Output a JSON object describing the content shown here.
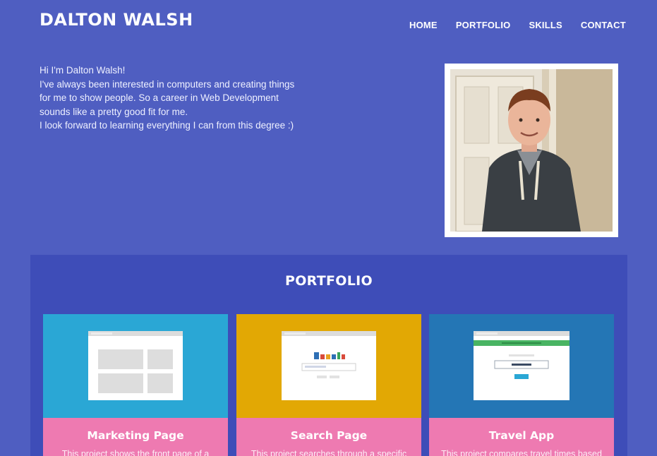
{
  "header": {
    "brand": "DALTON WALSH",
    "nav": [
      "HOME",
      "PORTFOLIO",
      "SKILLS",
      "CONTACT"
    ]
  },
  "intro": {
    "lines": [
      "Hi I'm Dalton Walsh!",
      "I've always been interested in computers and creating things",
      "for me to show people. So a career in Web Development",
      "sounds like a pretty good fit for me.",
      "I look forward to learning everything I can from this degree :)"
    ]
  },
  "portfolio": {
    "title": "PORTFOLIO",
    "cards": [
      {
        "title": "Marketing Page",
        "description": "This project shows the front page of a",
        "color": "#2aa7d5",
        "thumb_icon": "grid-layout-icon"
      },
      {
        "title": "Search Page",
        "description": "This project searches through a specific",
        "color": "#e2a804",
        "thumb_icon": "search-layout-icon"
      },
      {
        "title": "Travel App",
        "description": "This project compares travel times based",
        "color": "#2476b5",
        "thumb_icon": "form-layout-icon"
      }
    ]
  },
  "colors": {
    "background": "#4f5ec1",
    "portfolio_panel": "#3e4db8",
    "card_bottom": "#ee7ab1"
  }
}
